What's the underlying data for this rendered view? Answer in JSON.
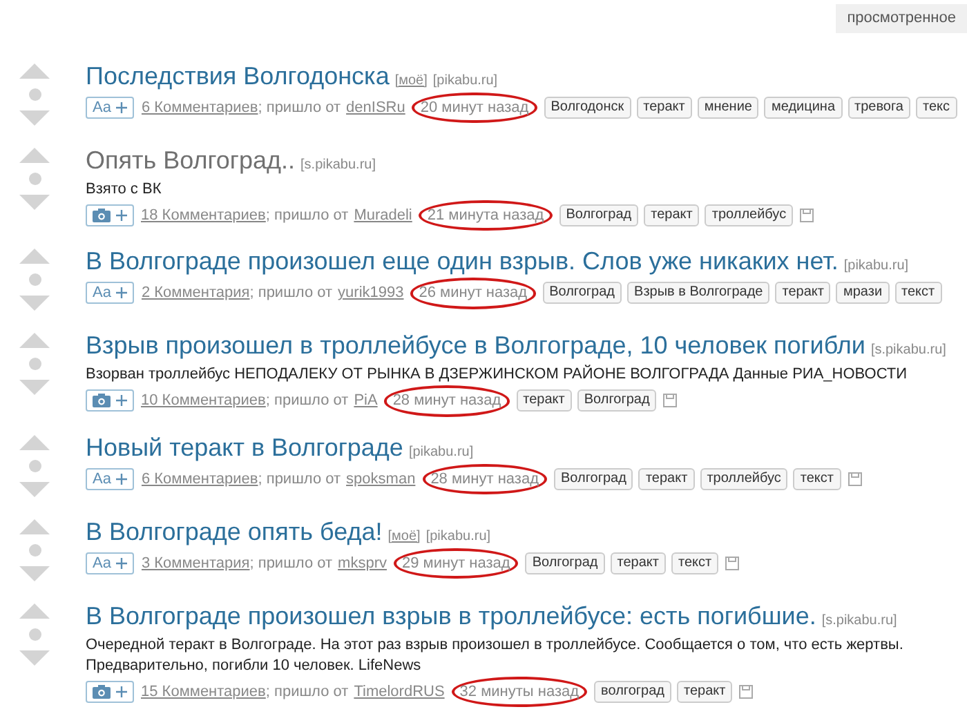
{
  "top_button": "просмотренное",
  "posts": [
    {
      "title": "Последствия Волгодонска",
      "visited": false,
      "mark": "[моё]",
      "source": "[pikabu.ru]",
      "kind": "text",
      "type_label": "Aa",
      "comments": "6 Комментариев",
      "from_label": "; пришло от",
      "author": "denISRu",
      "time": "20 минут назад",
      "tags": [
        "Волгодонск",
        "теракт",
        "мнение",
        "медицина",
        "тревога",
        "текс"
      ],
      "saveable": false
    },
    {
      "title": "Опять Волгоград..",
      "visited": true,
      "source": "[s.pikabu.ru]",
      "description": "Взято с ВК",
      "kind": "photo",
      "comments": "18 Комментариев",
      "from_label": "; пришло от",
      "author": "Muradeli",
      "time": "21 минута назад",
      "tags": [
        "Волгоград",
        "теракт",
        "троллейбус"
      ],
      "saveable": true
    },
    {
      "title": "В Волгограде произошел еще один взрыв. Слов уже никаких нет.",
      "visited": false,
      "source": "[pikabu.ru]",
      "kind": "text",
      "type_label": "Aa",
      "comments": "2 Комментария",
      "from_label": "; пришло от",
      "author": "yurik1993",
      "time": "26 минут назад",
      "tags": [
        "Волгоград",
        "Взрыв в Волгограде",
        "теракт",
        "мрази",
        "текст"
      ],
      "saveable": false
    },
    {
      "title": "Взрыв произошел в троллейбусе в Волгограде, 10 человек погибли",
      "visited": false,
      "source": "[s.pikabu.ru]",
      "description": "Взорван троллейбус НЕПОДАЛЕКУ ОТ РЫНКА В ДЗЕРЖИНСКОМ РАЙОНЕ ВОЛГОГРАДА Данные РИА_НОВОСТИ",
      "kind": "photo",
      "comments": "10 Комментариев",
      "from_label": "; пришло от",
      "author": "PiA",
      "time": "28 минут назад",
      "tags": [
        "теракт",
        "Волгоград"
      ],
      "saveable": true
    },
    {
      "title": "Новый теракт в Волгограде",
      "visited": false,
      "source": "[pikabu.ru]",
      "kind": "text",
      "type_label": "Aa",
      "comments": "6 Комментариев",
      "from_label": "; пришло от",
      "author": "spoksman",
      "time": "28 минут назад",
      "tags": [
        "Волгоград",
        "теракт",
        "троллейбус",
        "текст"
      ],
      "saveable": true
    },
    {
      "title": "В Волгограде опять беда!",
      "visited": false,
      "mark": "[моё]",
      "source": "[pikabu.ru]",
      "kind": "text",
      "type_label": "Aa",
      "comments": "3 Комментария",
      "from_label": "; пришло от",
      "author": "mksprv",
      "time": "29 минут назад",
      "tags": [
        "Волгоград",
        "теракт",
        "текст"
      ],
      "saveable": true
    },
    {
      "title": "В Волгограде произошел взрыв в троллейбусе: есть погибшие.",
      "visited": false,
      "source": "[s.pikabu.ru]",
      "description": "Очередной теракт в Волгограде. На этот раз взрыв произошел в троллейбусе. Сообщается о том, что есть жертвы. Предварительно, погибли 10 человек. LifeNews",
      "kind": "photo",
      "comments": "15 Комментариев",
      "from_label": "; пришло от",
      "author": "TimelordRUS",
      "time": "32 минуты назад",
      "tags": [
        "волгоград",
        "теракт"
      ],
      "saveable": true
    }
  ]
}
